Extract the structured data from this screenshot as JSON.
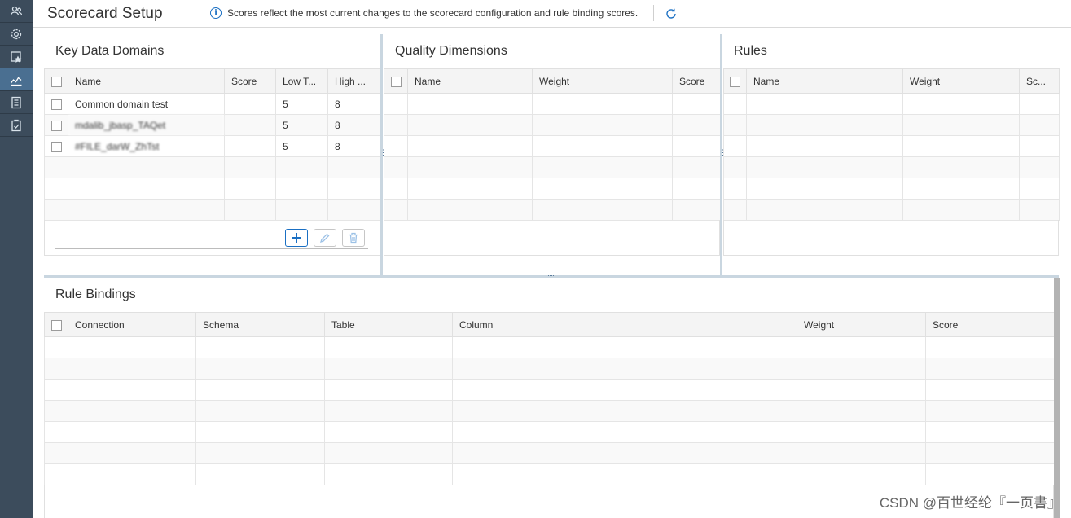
{
  "header": {
    "title": "Scorecard Setup",
    "info_text": "Scores reflect the most current changes to the scorecard configuration and rule binding scores."
  },
  "sidebar": {
    "items": [
      {
        "icon": "users-icon",
        "active": false
      },
      {
        "icon": "gear-icon",
        "active": false
      },
      {
        "icon": "star-document-icon",
        "active": false
      },
      {
        "icon": "scorecard-chart-icon",
        "active": true
      },
      {
        "icon": "notebook-icon",
        "active": false
      },
      {
        "icon": "clipboard-check-icon",
        "active": false
      }
    ]
  },
  "key_data_domains": {
    "title": "Key Data Domains",
    "columns": [
      "Name",
      "Score",
      "Low T...",
      "High ..."
    ],
    "rows": [
      {
        "name": "Common domain test",
        "score": "",
        "low": "5",
        "high": "8"
      },
      {
        "name": "mdalib_jbasp_TAQet",
        "score": "",
        "low": "5",
        "high": "8"
      },
      {
        "name": "#FILE_darW_ZhTst",
        "score": "",
        "low": "5",
        "high": "8"
      }
    ]
  },
  "quality_dimensions": {
    "title": "Quality Dimensions",
    "columns": [
      "Name",
      "Weight",
      "Score"
    ]
  },
  "rules": {
    "title": "Rules",
    "columns": [
      "Name",
      "Weight",
      "Sc..."
    ]
  },
  "rule_bindings": {
    "title": "Rule Bindings",
    "columns": [
      "Connection",
      "Schema",
      "Table",
      "Column",
      "Weight",
      "Score"
    ]
  },
  "watermark": "CSDN @百世经纶『一页書』",
  "colors": {
    "sidebar_bg": "#3c4c5c",
    "sidebar_active": "#4a6f91",
    "accent": "#1a6fc3"
  }
}
